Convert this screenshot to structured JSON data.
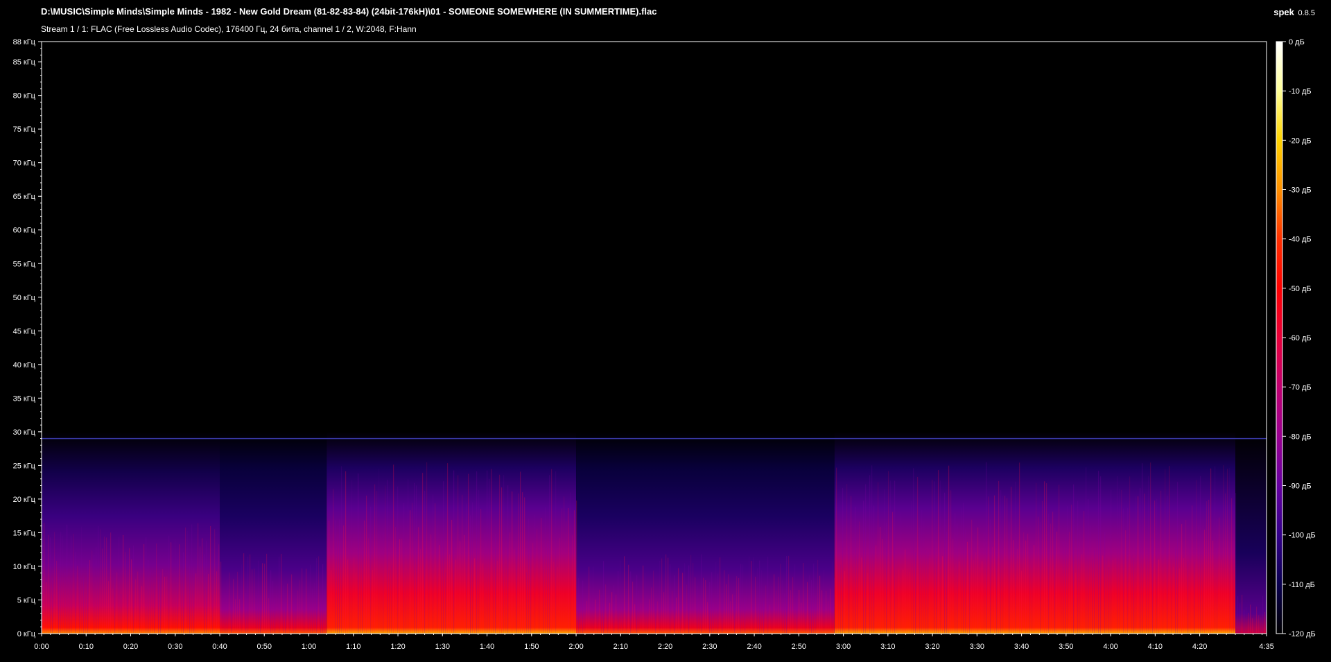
{
  "header": {
    "file_path": "D:\\MUSIC\\Simple Minds\\Simple Minds - 1982 - New Gold Dream (81-82-83-84) (24bit-176kH)\\01 - SOMEONE SOMEWHERE (IN SUMMERTIME).flac",
    "stream_info": "Stream 1 / 1: FLAC (Free Lossless Audio Codec), 176400 Гц, 24 бита, channel 1 / 2, W:2048, F:Hann",
    "app_name": "spek",
    "app_version": "0.8.5"
  },
  "chart_data": {
    "type": "heatmap",
    "x_axis": {
      "unit": "seconds",
      "min": 0,
      "max": 275,
      "tick_values": [
        0,
        10,
        20,
        30,
        40,
        50,
        60,
        70,
        80,
        90,
        100,
        110,
        120,
        130,
        140,
        150,
        160,
        170,
        180,
        190,
        200,
        210,
        220,
        230,
        240,
        250,
        260,
        275
      ],
      "tick_labels": [
        "0:00",
        "0:10",
        "0:20",
        "0:30",
        "0:40",
        "0:50",
        "1:00",
        "1:10",
        "1:20",
        "1:30",
        "1:40",
        "1:50",
        "2:00",
        "2:10",
        "2:20",
        "2:30",
        "2:40",
        "2:50",
        "3:00",
        "3:10",
        "3:20",
        "3:30",
        "3:40",
        "3:50",
        "4:00",
        "4:10",
        "4:20",
        "4:35"
      ]
    },
    "y_axis": {
      "unit": "kHz",
      "min": 0,
      "max": 88,
      "tick_values": [
        0,
        5,
        10,
        15,
        20,
        25,
        30,
        35,
        40,
        45,
        50,
        55,
        60,
        65,
        70,
        75,
        80,
        85,
        88
      ],
      "tick_labels": [
        "0 кГц",
        "5 кГц",
        "10 кГц",
        "15 кГц",
        "20 кГц",
        "25 кГц",
        "30 кГц",
        "35 кГц",
        "40 кГц",
        "45 кГц",
        "50 кГц",
        "55 кГц",
        "60 кГц",
        "65 кГц",
        "70 кГц",
        "75 кГц",
        "80 кГц",
        "85 кГц",
        "88 кГц"
      ]
    },
    "colorbar": {
      "unit": "dB",
      "min": -120,
      "max": 0,
      "tick_values": [
        0,
        -10,
        -20,
        -30,
        -40,
        -50,
        -60,
        -70,
        -80,
        -90,
        -100,
        -110,
        -120
      ],
      "tick_labels": [
        "0 дБ",
        "-10 дБ",
        "-20 дБ",
        "-30 дБ",
        "-40 дБ",
        "-50 дБ",
        "-60 дБ",
        "-70 дБ",
        "-80 дБ",
        "-90 дБ",
        "-100 дБ",
        "-110 дБ",
        "-120 дБ"
      ],
      "colors": [
        "#ffffff",
        "#ffff99",
        "#ffd400",
        "#ff9000",
        "#ff3000",
        "#ff0000",
        "#e8003a",
        "#c00070",
        "#9a0090",
        "#6600a0",
        "#34008a",
        "#0a0050",
        "#000000"
      ]
    },
    "spectral_content": {
      "max_content_khz": 30,
      "steady_line_khz": 29,
      "sections": [
        {
          "start": 0,
          "end": 40,
          "level": "medium"
        },
        {
          "start": 40,
          "end": 64,
          "level": "low"
        },
        {
          "start": 64,
          "end": 120,
          "level": "high"
        },
        {
          "start": 120,
          "end": 178,
          "level": "low"
        },
        {
          "start": 178,
          "end": 268,
          "level": "high"
        },
        {
          "start": 268,
          "end": 275,
          "level": "fade"
        }
      ]
    }
  }
}
